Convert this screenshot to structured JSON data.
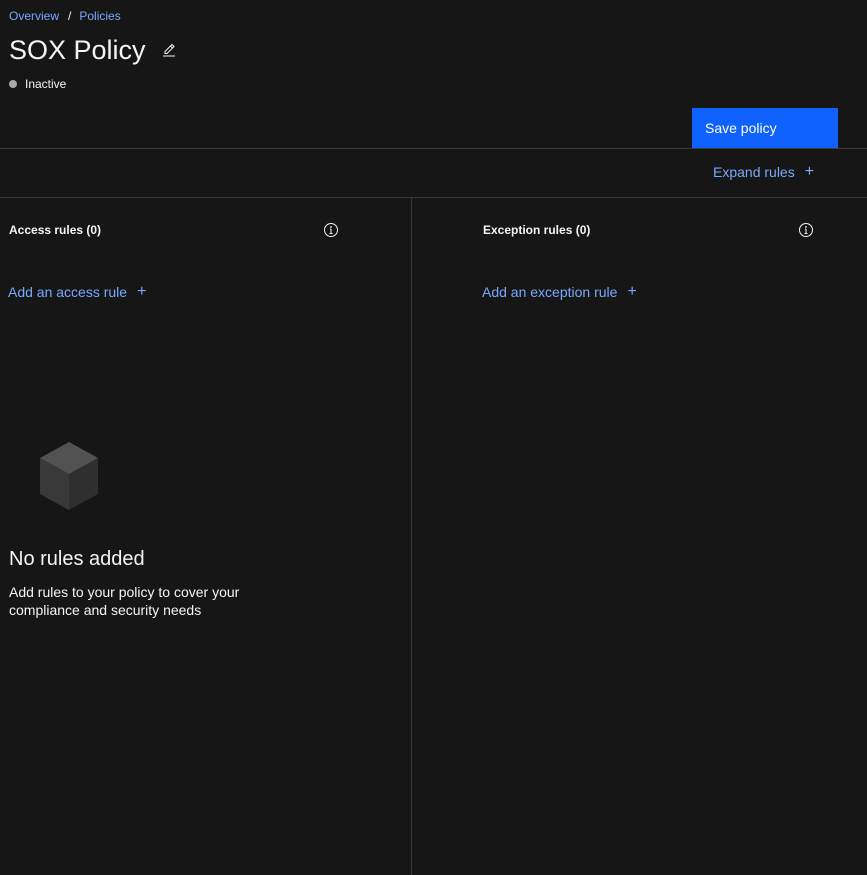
{
  "breadcrumb": {
    "items": [
      "Overview",
      "Policies"
    ],
    "separator": "/"
  },
  "header": {
    "title": "SOX Policy",
    "edit_icon": "pencil-icon"
  },
  "status": {
    "label": "Inactive",
    "dot_color": "#a8a8a8"
  },
  "toolbar": {
    "save_label": "Save policy",
    "expand_label": "Expand rules",
    "expand_icon": "plus-icon"
  },
  "access_rules": {
    "title": "Access rules (0)",
    "info_icon": "info-icon",
    "add_label": "Add an access rule",
    "add_icon": "plus-icon"
  },
  "exception_rules": {
    "title": "Exception rules (0)",
    "info_icon": "info-icon",
    "add_label": "Add an exception rule",
    "add_icon": "plus-icon"
  },
  "empty_state": {
    "icon": "cube-icon",
    "title": "No rules added",
    "description": "Add rules to your policy to cover your compliance and security needs"
  },
  "colors": {
    "background": "#161616",
    "link": "#78a9ff",
    "primary_button": "#0f62fe",
    "divider": "#393939",
    "text": "#f4f4f4"
  }
}
